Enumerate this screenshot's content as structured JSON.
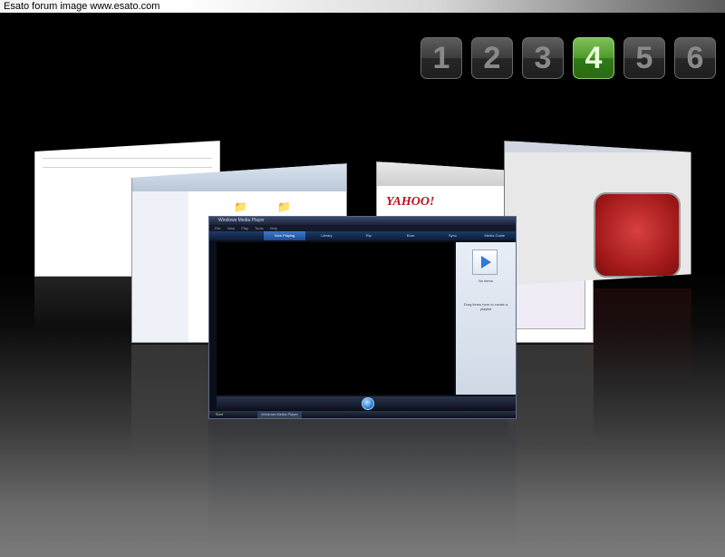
{
  "caption": {
    "text": "Esato forum image www.esato.com"
  },
  "desktop_switcher": {
    "buttons": [
      "1",
      "2",
      "3",
      "4",
      "5",
      "6"
    ],
    "active": "4",
    "active_color": "#4f9a2b"
  },
  "yahoo_window": {
    "logo": "YAHOO!"
  },
  "media_player": {
    "title": "Windows Media Player",
    "menu": [
      "File",
      "View",
      "Play",
      "Tools",
      "Help"
    ],
    "tabs": [
      "Now Playing",
      "Library",
      "Rip",
      "Burn",
      "Sync",
      "Media Guide"
    ],
    "active_tab": "Now Playing",
    "pane_header": "No items",
    "pane_hint": "Drag items here to create a playlist",
    "taskbar_start": "Start",
    "taskbar_task": "Windows Media Player"
  }
}
